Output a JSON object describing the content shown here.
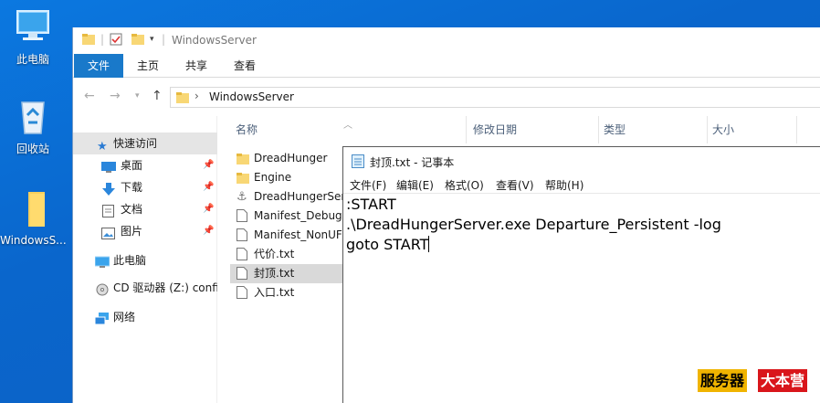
{
  "desktop": {
    "icons": [
      {
        "label": "此电脑",
        "icon": "computer-icon"
      },
      {
        "label": "回收站",
        "icon": "recycle-bin-icon"
      },
      {
        "label": "WindowsS...",
        "icon": "folder-icon"
      }
    ]
  },
  "explorer": {
    "title": "WindowsServer",
    "ribbon_tabs": [
      "文件",
      "主页",
      "共享",
      "查看"
    ],
    "address": {
      "crumb": "WindowsServer"
    },
    "columns": [
      "名称",
      "修改日期",
      "类型",
      "大小"
    ],
    "nav": {
      "quick_access": "快速访问",
      "pinned": [
        "桌面",
        "下载",
        "文档",
        "图片"
      ],
      "this_pc": "此电脑",
      "cd_drive": "CD 驱动器 (Z:) confi",
      "network": "网络"
    },
    "files": [
      {
        "name": "DreadHunger",
        "icon": "folder-icon"
      },
      {
        "name": "Engine",
        "icon": "folder-icon"
      },
      {
        "name": "DreadHungerServer",
        "icon": "app-icon"
      },
      {
        "name": "Manifest_DebugFiles",
        "icon": "text-file-icon"
      },
      {
        "name": "Manifest_NonUFSFiles",
        "icon": "text-file-icon"
      },
      {
        "name": "代价.txt",
        "icon": "text-file-icon"
      },
      {
        "name": "封顶.txt",
        "icon": "text-file-icon"
      },
      {
        "name": "入口.txt",
        "icon": "text-file-icon"
      }
    ]
  },
  "notepad": {
    "title": "封顶.txt - 记事本",
    "menu": [
      "文件(F)",
      "编辑(E)",
      "格式(O)",
      "查看(V)",
      "帮助(H)"
    ],
    "lines": [
      ":START",
      ".\\DreadHungerServer.exe Departure_Persistent -log",
      "goto START"
    ]
  },
  "watermark": {
    "part1": "服务器",
    "part2": "大本营"
  }
}
